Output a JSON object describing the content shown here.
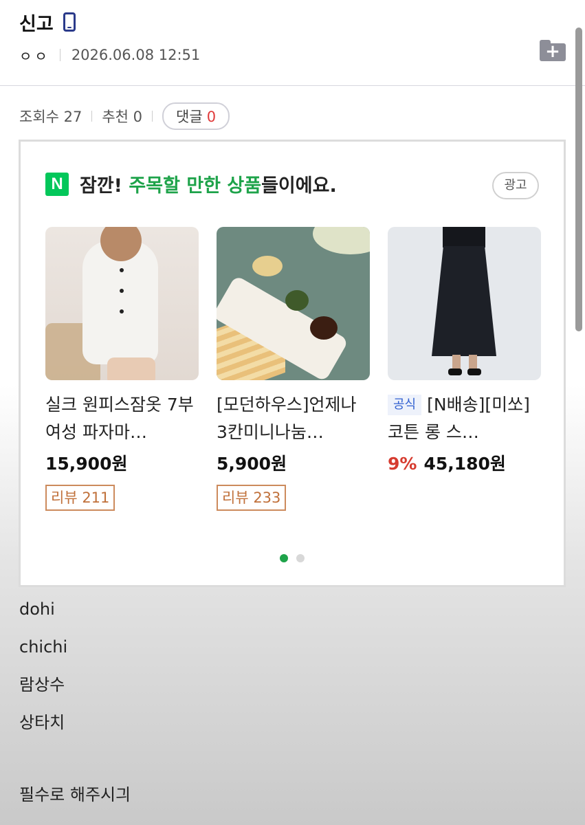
{
  "post": {
    "title": "신고",
    "author": "ㅇㅇ",
    "date": "2026.06.08 12:51"
  },
  "icons": {
    "device": "mobile-phone-icon",
    "save": "folder-add-icon",
    "ad_logo": "naver-n-logo"
  },
  "stats": {
    "views_label": "조회수 27",
    "likes_label": "추천 0",
    "comments_label": "댓글",
    "comments_count": "0"
  },
  "ad": {
    "logo_text": "N",
    "headline_prefix": "잠깐! ",
    "headline_highlight": "주목할 만한 상품",
    "headline_suffix": "들이에요.",
    "badge": "광고",
    "products": [
      {
        "title": "실크 원피스잠옷 7부 여성 파자마…",
        "official": "",
        "discount": "",
        "price": "15,900원",
        "review": "리뷰 211"
      },
      {
        "title": "[모던하우스]언제나 3칸미니나눔…",
        "official": "",
        "discount": "",
        "price": "5,900원",
        "review": "리뷰 233"
      },
      {
        "title": "[N배송][미쏘] 코튼 롱 스…",
        "official": "공식",
        "discount": "9%",
        "price": "45,180원",
        "review": ""
      }
    ],
    "pagination": {
      "pages": 2,
      "current": 1
    }
  },
  "content": {
    "lines": [
      "dohi",
      "chichi",
      "람상수",
      "상타치"
    ],
    "closing": "필수로 해주시긔"
  },
  "colors": {
    "accent_green": "#03c75a",
    "highlight_green": "#1ea34a",
    "comment_count_red": "#e03b3b",
    "discount_red": "#d63b2f",
    "review_border": "#cc8a5c"
  }
}
